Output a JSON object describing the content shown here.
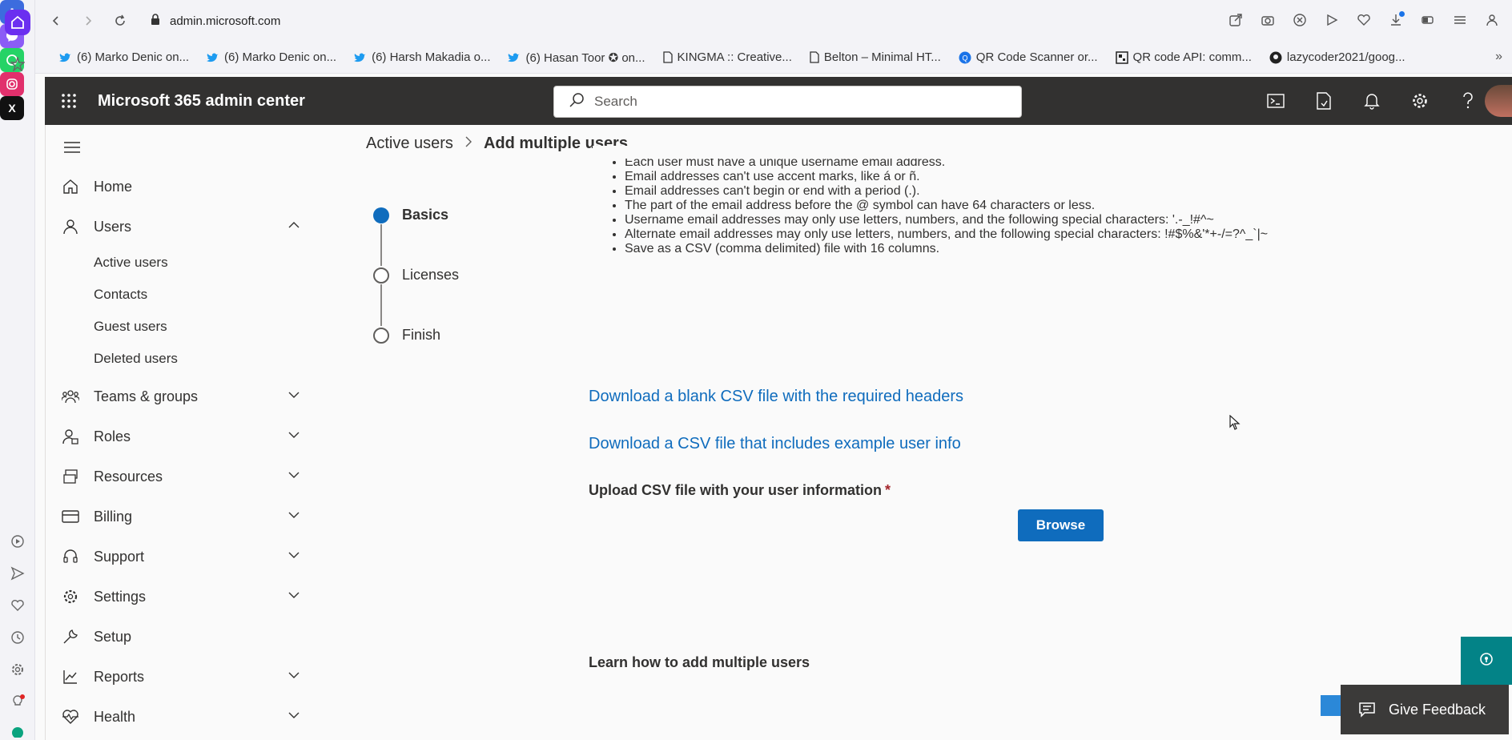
{
  "browser": {
    "url_host": "admin.microsoft.com",
    "bookmarks": [
      {
        "label": "(6) Marko Denic on...",
        "icon": "twitter-icon"
      },
      {
        "label": "(6) Marko Denic on...",
        "icon": "twitter-icon"
      },
      {
        "label": "(6) Harsh Makadia o...",
        "icon": "twitter-icon"
      },
      {
        "label": "(6) Hasan Toor ✪ on...",
        "icon": "twitter-icon"
      },
      {
        "label": "KINGMA :: Creative...",
        "icon": "page-icon"
      },
      {
        "label": "Belton – Minimal HT...",
        "icon": "page-icon"
      },
      {
        "label": "QR Code Scanner or...",
        "icon": "qr-icon"
      },
      {
        "label": "QR code API: comm...",
        "icon": "qr-code-icon"
      },
      {
        "label": "lazycoder2021/goog...",
        "icon": "github-icon"
      }
    ]
  },
  "header": {
    "app_title": "Microsoft 365 admin center",
    "search_placeholder": "Search"
  },
  "nav": {
    "home": "Home",
    "users": "Users",
    "users_sub": [
      "Active users",
      "Contacts",
      "Guest users",
      "Deleted users"
    ],
    "teams_groups": "Teams & groups",
    "roles": "Roles",
    "resources": "Resources",
    "billing": "Billing",
    "support": "Support",
    "settings": "Settings",
    "setup": "Setup",
    "reports": "Reports",
    "health": "Health"
  },
  "breadcrumb": {
    "parent": "Active users",
    "current": "Add multiple users"
  },
  "steps": [
    {
      "label": "Basics",
      "state": "current"
    },
    {
      "label": "Licenses",
      "state": "pending"
    },
    {
      "label": "Finish",
      "state": "pending"
    }
  ],
  "rules": [
    "Each user must have a unique username email address.",
    "Email addresses can't use accent marks, like á or ñ.",
    "Email addresses can't begin or end with a period (.).",
    "The part of the email address before the @ symbol can have 64 characters or less.",
    "Username email addresses may only use letters, numbers, and the following special characters: '.-_!#^~",
    "Alternate email addresses may only use letters, numbers, and the following special characters: !#$%&'*+-/=?^_`|~",
    "Save as a CSV (comma delimited) file with 16 columns."
  ],
  "links": {
    "blank_csv": "Download a blank CSV file with the required headers",
    "example_csv": "Download a CSV file that includes example user info"
  },
  "upload": {
    "label": "Upload CSV file with your user information",
    "required_marker": "*",
    "browse": "Browse"
  },
  "learn": "Learn how to add multiple users",
  "feedback": "Give Feedback",
  "colors": {
    "accent": "#0f6cbd",
    "header_bg": "#323130",
    "help_bg": "#038387",
    "opera_accent": "#6b2ff0"
  }
}
